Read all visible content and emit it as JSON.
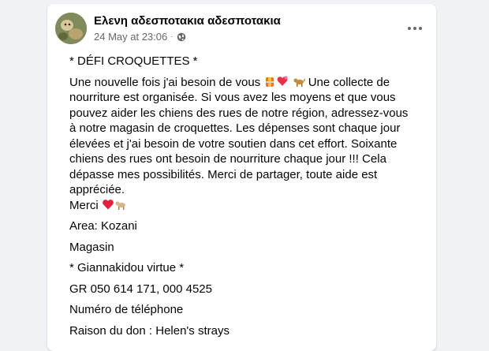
{
  "post": {
    "author": "Ελενη αδεσποτακια αδεσποτακια",
    "timestamp": "24 May at 23:06",
    "meta_separator": "·",
    "privacy_icon": "globe-icon",
    "more_icon": "more-options-icon",
    "title_line": "* DÉFI CROQUETTES *",
    "paragraph_lead": "Une nouvelle fois j'ai besoin de vous",
    "paragraph_rest": "Une collecte de nourriture est organisée. Si vous avez les moyens et que vous pouvez aider les chiens des rues de notre région, adressez-vous à notre magasin de croquettes. Les dépenses sont chaque jour élevées et j'ai besoin de votre soutien dans cet effort. Soixante chiens des rues ont besoin de nourriture chaque jour !!! Cela dépasse mes possibilités. Merci de partager, toute aide est appréciée.",
    "thanks": "Merci",
    "area": "Area: Kozani",
    "magasin": "Magasin",
    "shop_name": "* Giannakidou virtue *",
    "iban": "GR 050 614 171, 000 4525",
    "phone_label": "Numéro de téléphone",
    "reason": "Raison du don : Helen's strays"
  },
  "colors": {
    "background": "#f0f2f5",
    "card": "#ffffff",
    "text": "#050505",
    "secondary_text": "#65676b",
    "heart": "#e41e3f"
  }
}
